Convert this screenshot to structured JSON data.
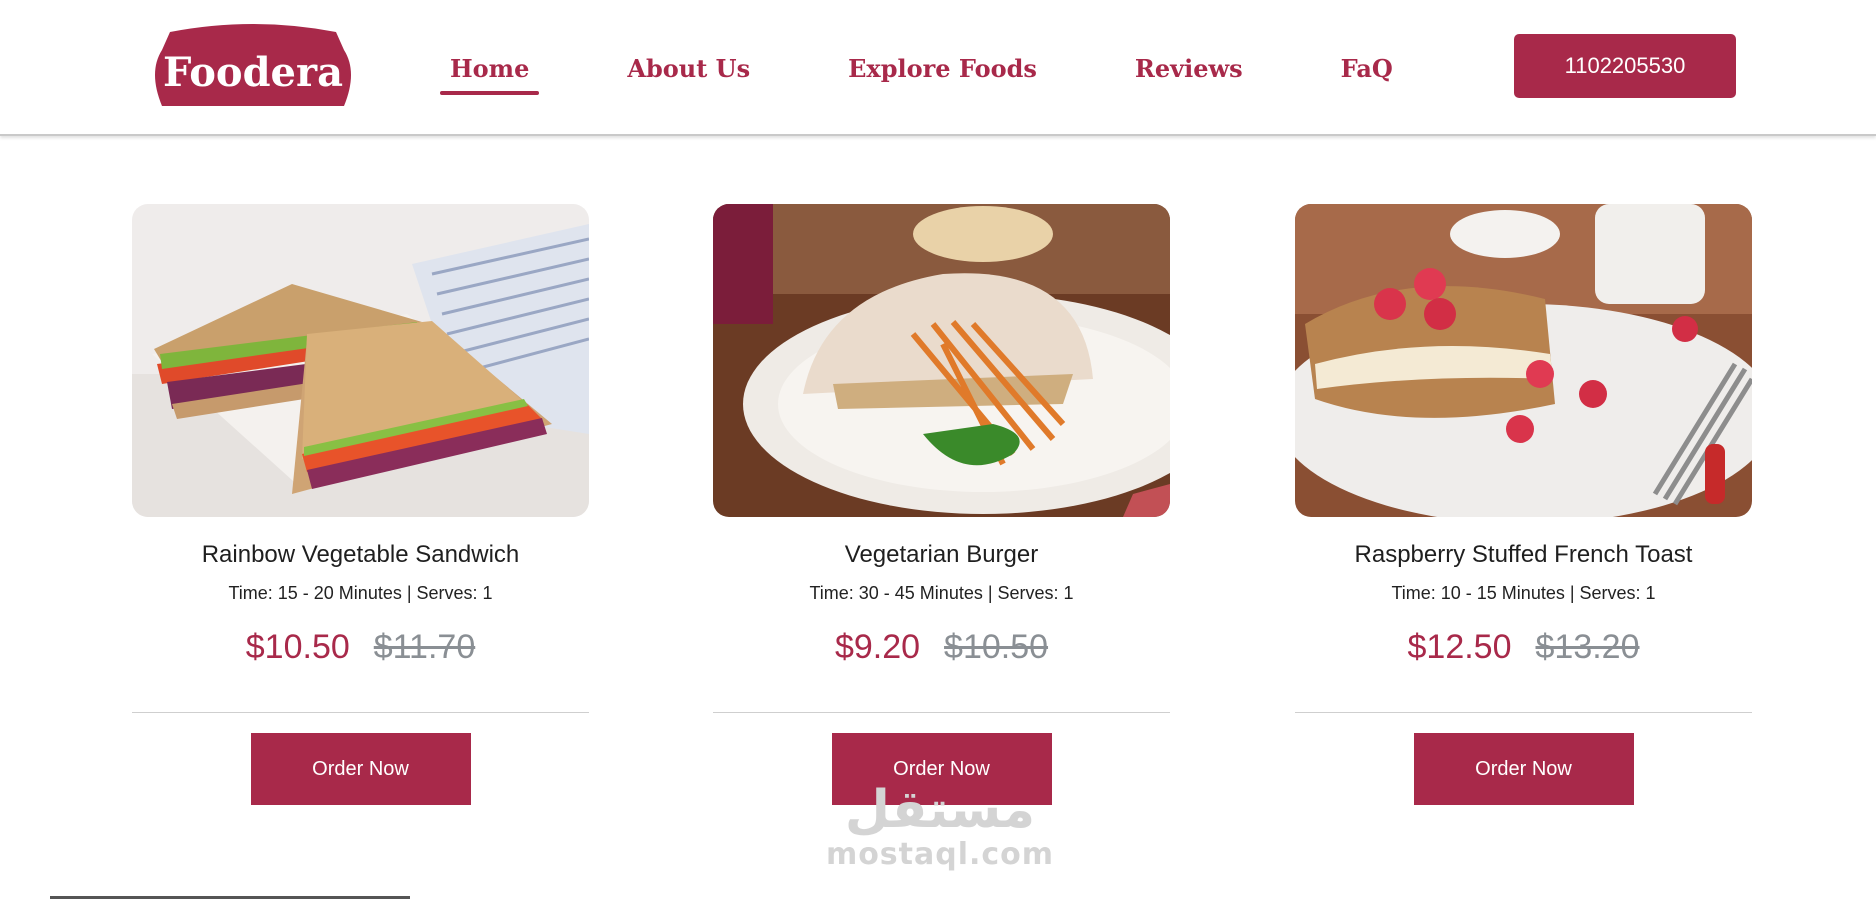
{
  "brand": {
    "name": "Foodera",
    "color": "#a8294a"
  },
  "nav": {
    "items": [
      {
        "label": "Home",
        "active": true
      },
      {
        "label": "About Us",
        "active": false
      },
      {
        "label": "Explore Foods",
        "active": false
      },
      {
        "label": "Reviews",
        "active": false
      },
      {
        "label": "FaQ",
        "active": false
      }
    ],
    "phone": "1102205530"
  },
  "cards": [
    {
      "title": "Rainbow Vegetable Sandwich",
      "meta": "Time: 15 - 20 Minutes | Serves: 1",
      "price": "$10.50",
      "old_price": "$11.70",
      "button": "Order Now",
      "image": "sandwich-photo"
    },
    {
      "title": "Vegetarian Burger",
      "meta": "Time: 30 - 45 Minutes | Serves: 1",
      "price": "$9.20",
      "old_price": "$10.50",
      "button": "Order Now",
      "image": "burger-photo"
    },
    {
      "title": "Raspberry Stuffed French Toast",
      "meta": "Time: 10 - 15 Minutes | Serves: 1",
      "price": "$12.50",
      "old_price": "$13.20",
      "button": "Order Now",
      "image": "french-toast-photo"
    }
  ],
  "watermark": {
    "arabic": "مستقل",
    "latin": "mostaql.com"
  }
}
